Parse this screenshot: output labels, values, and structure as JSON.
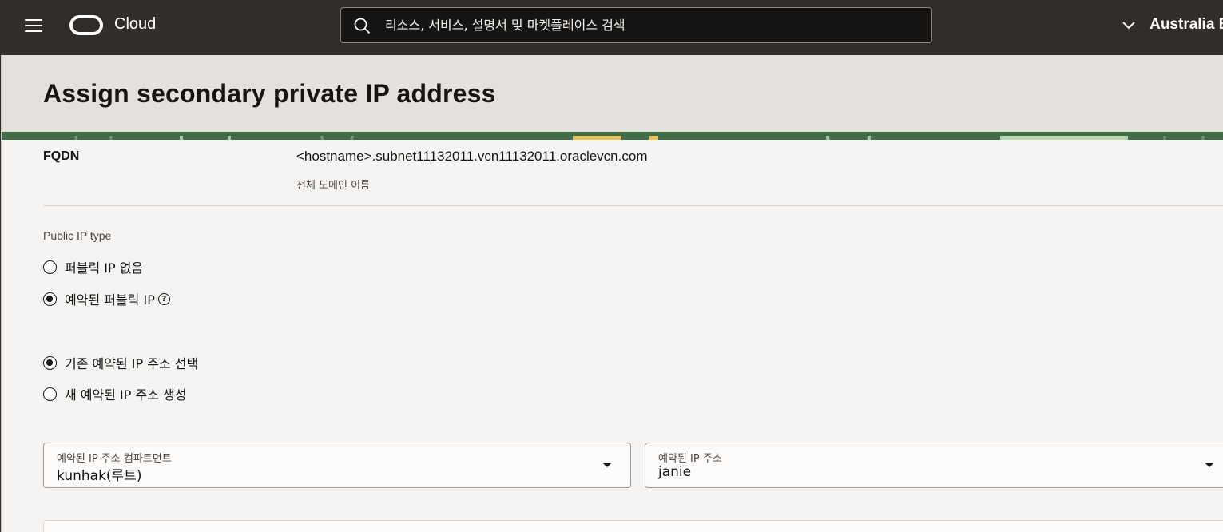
{
  "topbar": {
    "brand": "Cloud",
    "search_placeholder": "리소스, 서비스, 설명서 및 마켓플레이스 검색",
    "region": "Australia E"
  },
  "panel": {
    "title": "Assign secondary private IP address"
  },
  "fqdn": {
    "label": "FQDN",
    "value": "<hostname>.subnet11132011.vcn11132011.oraclevcn.com",
    "help": "전체 도메인 이름"
  },
  "public_ip": {
    "section_label": "Public IP type",
    "options": [
      {
        "label": "퍼블릭 IP 없음",
        "checked": false
      },
      {
        "label": "예약된 퍼블릭 IP",
        "checked": true,
        "help_icon": "?"
      }
    ]
  },
  "reserved_ip": {
    "options": [
      {
        "label": "기존 예약된 IP 주소 선택",
        "checked": true
      },
      {
        "label": "새 예약된 IP 주소 생성",
        "checked": false
      }
    ],
    "compartment": {
      "label": "예약된 IP 주소 컴파트먼트",
      "value": "kunhak(루트)"
    },
    "address": {
      "label": "예약된 IP 주소",
      "value": "janie"
    }
  }
}
